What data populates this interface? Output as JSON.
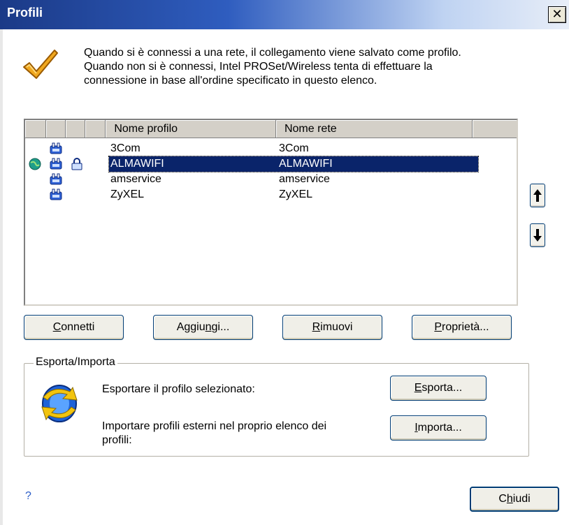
{
  "window": {
    "title": "Profili",
    "close_glyph": "✕"
  },
  "intro": {
    "icon": "checkmark-icon",
    "lines": [
      "Quando si è connessi a una rete, il collegamento viene salvato come profilo.",
      "Quando non si è connessi, Intel PROSet/Wireless tenta di effettuare la",
      "connessione in base all'ordine specificato in questo elenco."
    ]
  },
  "profiles": {
    "columns": {
      "profile_name": "Nome profilo",
      "network_name": "Nome rete"
    },
    "rows": [
      {
        "profile": "3Com",
        "network": "3Com",
        "icons": [
          "network-adapter-icon"
        ]
      },
      {
        "profile": "ALMAWIFI",
        "network": "ALMAWIFI",
        "selected": true,
        "icons": [
          "connected-globe-icon",
          "network-adapter-icon",
          "lock-icon"
        ]
      },
      {
        "profile": "amservice",
        "network": "amservice",
        "icons": [
          "network-adapter-icon"
        ]
      },
      {
        "profile": "ZyXEL",
        "network": "ZyXEL",
        "icons": [
          "network-adapter-icon"
        ]
      }
    ],
    "move_up_icon": "arrow-up-icon",
    "move_down_icon": "arrow-down-icon"
  },
  "actions": {
    "connect": {
      "accel": "C",
      "rest": "onnetti"
    },
    "add": {
      "pre": "Aggiu",
      "accel": "n",
      "rest": "gi..."
    },
    "remove": {
      "accel": "R",
      "rest": "imuovi"
    },
    "properties": {
      "accel": "P",
      "rest": "roprietà..."
    }
  },
  "export_import": {
    "legend": "Esporta/Importa",
    "icon": "sync-arrows-icon",
    "export_label": "Esportare il profilo selezionato:",
    "import_label_lines": [
      "Importare profili esterni nel proprio elenco dei",
      "profili:"
    ],
    "export_button": {
      "accel": "E",
      "rest": "sporta..."
    },
    "import_button": {
      "accel": "I",
      "rest": "mporta..."
    }
  },
  "footer": {
    "help": "?",
    "close_button": {
      "pre": "C",
      "accel": "h",
      "rest": "iudi"
    }
  },
  "colors": {
    "selection": "#0a246a",
    "titlebar": "#2f5dbf",
    "button_border": "#003c74"
  }
}
